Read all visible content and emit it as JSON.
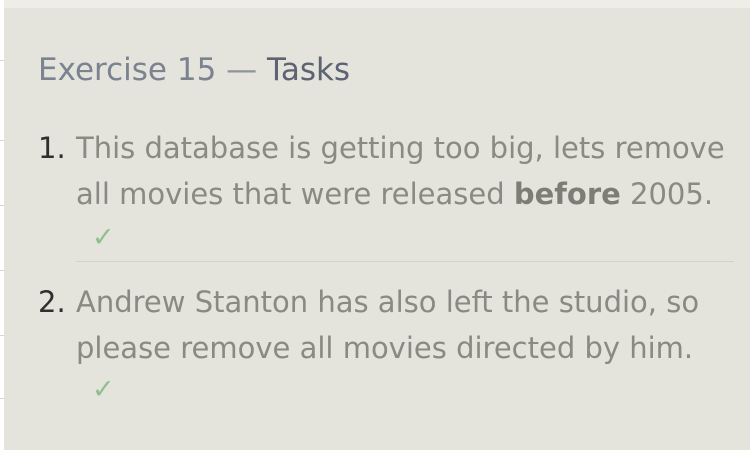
{
  "header": {
    "exercise": "Exercise 15",
    "separator": "—",
    "section": "Tasks"
  },
  "tasks": [
    {
      "number": "1.",
      "text_before": "This database is getting too big, lets remove all movies that were released ",
      "text_bold": "before",
      "text_after": " 2005.",
      "check": "✓"
    },
    {
      "number": "2.",
      "text": "Andrew Stanton has also left the studio, so please remove all movies directed by him.",
      "check": "✓"
    }
  ],
  "colors": {
    "panel_background": "#e4e3dc",
    "title": "#7b8290",
    "task_text": "#8a8a82",
    "check": "#8fc08c"
  }
}
